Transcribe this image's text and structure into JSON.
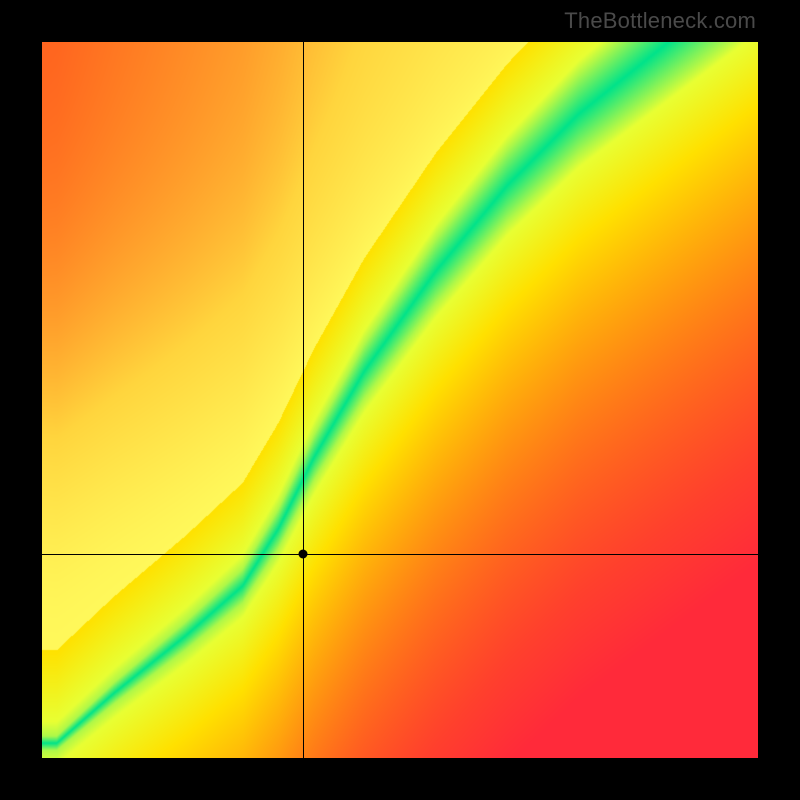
{
  "watermark": "TheBottleneck.com",
  "chart_data": {
    "type": "heatmap",
    "title": "",
    "xlabel": "",
    "ylabel": "",
    "xlim": [
      0,
      1
    ],
    "ylim": [
      0,
      1
    ],
    "grid": false,
    "legend": false,
    "colors": {
      "low": "#ff2a3a",
      "mid_low": "#ff8a00",
      "mid": "#ffe100",
      "mid_high": "#e8ff33",
      "optimal": "#00e38a",
      "high": "#fff85a"
    },
    "optimal_band": {
      "description": "green diagonal band where configuration is balanced",
      "points": [
        {
          "x": 0.02,
          "center_y": 0.02,
          "half_width": 0.01
        },
        {
          "x": 0.1,
          "center_y": 0.09,
          "half_width": 0.015
        },
        {
          "x": 0.2,
          "center_y": 0.17,
          "half_width": 0.02
        },
        {
          "x": 0.28,
          "center_y": 0.24,
          "half_width": 0.024
        },
        {
          "x": 0.33,
          "center_y": 0.32,
          "half_width": 0.028
        },
        {
          "x": 0.38,
          "center_y": 0.42,
          "half_width": 0.032
        },
        {
          "x": 0.45,
          "center_y": 0.54,
          "half_width": 0.038
        },
        {
          "x": 0.55,
          "center_y": 0.68,
          "half_width": 0.045
        },
        {
          "x": 0.65,
          "center_y": 0.8,
          "half_width": 0.05
        },
        {
          "x": 0.75,
          "center_y": 0.9,
          "half_width": 0.055
        },
        {
          "x": 0.85,
          "center_y": 0.98,
          "half_width": 0.06
        }
      ]
    },
    "crosshair": {
      "x": 0.365,
      "y": 0.285
    },
    "marker": {
      "x": 0.365,
      "y": 0.285
    },
    "annotations": []
  }
}
